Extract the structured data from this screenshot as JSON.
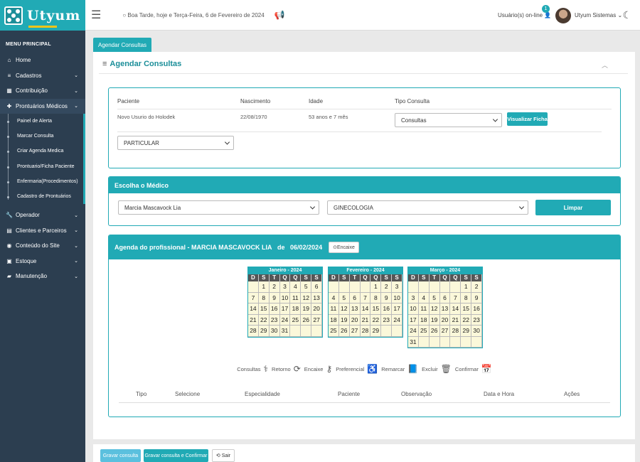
{
  "brand": {
    "name": "Utyum"
  },
  "topbar": {
    "greeting": "Boa Tarde, hoje e Terça-Feira, 6 de Fevereiro de 2024",
    "online_label": "Usuário(s) on-line",
    "online_count": "1",
    "user_name": "Utyum Sistemas"
  },
  "sidebar": {
    "heading": "MENU PRINCIPAL",
    "items": [
      {
        "label": "Home",
        "icon": "home-icon"
      },
      {
        "label": "Cadastros",
        "icon": "database-icon"
      },
      {
        "label": "Contribuição",
        "icon": "table-icon"
      },
      {
        "label": "Prontuários Médicos",
        "icon": "medkit-icon"
      }
    ],
    "sub_items": [
      "Painel de Alerta",
      "Marcar Consulta",
      "Criar Agenda Medica",
      "Prontuario/Ficha Paciente",
      "Enfermaria(Procedimentos)",
      "Cadastro de Prontuários"
    ],
    "items2": [
      {
        "label": "Operador",
        "icon": "wrench-icon"
      },
      {
        "label": "Clientes e Parceiros",
        "icon": "id-card-icon"
      },
      {
        "label": "Conteúdo do Site",
        "icon": "globe-icon"
      },
      {
        "label": "Estoque",
        "icon": "box-icon"
      },
      {
        "label": "Manutenção",
        "icon": "folder-icon"
      }
    ]
  },
  "tab": {
    "label": "Agendar Consultas"
  },
  "page": {
    "title": "Agendar Consultas"
  },
  "patient": {
    "headers": [
      "Paciente",
      "Nascimento",
      "Idade",
      "Tipo Consulta"
    ],
    "name": "Novo Usurio do Holodek",
    "birth": "22/08/1970",
    "age": "53 anos e 7 mês",
    "consult_type": "Consultas",
    "view_button": "Visualizar Ficha",
    "plan": "PARTICULAR"
  },
  "doctor": {
    "title": "Escolha o Médico",
    "doctor": "Marcia Mascavock Lia",
    "specialty": "GINECOLOGIA",
    "clear_button": "Limpar"
  },
  "agenda": {
    "title_prefix": "Agenda do profissional - MARCIA MASCAVOCK LIA",
    "title_de": "de",
    "date": "06/02/2024",
    "encaixe_button": "Encaixe",
    "weekday_headers": [
      "D",
      "S",
      "T",
      "Q",
      "Q",
      "S",
      "S"
    ],
    "calendars": [
      {
        "title": "Janeiro - 2024",
        "offset": 1,
        "days": 31
      },
      {
        "title": "Fevereiro - 2024",
        "offset": 4,
        "days": 29
      },
      {
        "title": "Março - 2024",
        "offset": 5,
        "days": 31
      }
    ],
    "legend": [
      {
        "label": "Consultas",
        "icon": "stethoscope-icon",
        "glyph": "⚕"
      },
      {
        "label": "Retorno",
        "icon": "refresh-icon",
        "glyph": "⟳"
      },
      {
        "label": "Encaixe",
        "icon": "key-icon",
        "glyph": "⚷"
      },
      {
        "label": "Preferencial",
        "icon": "wheelchair-icon",
        "glyph": "♿"
      },
      {
        "label": "Remarcar",
        "icon": "book-icon",
        "glyph": "📘"
      },
      {
        "label": "Excluir",
        "icon": "trash-icon",
        "glyph": "🗑"
      },
      {
        "label": "Confirmar",
        "icon": "calendar-check-icon",
        "glyph": "📅"
      }
    ],
    "table_headers": [
      "Tipo",
      "Selecione",
      "Especialidade",
      "Paciente",
      "Observação",
      "Data e Hora",
      "Ações"
    ]
  },
  "footer": {
    "save": "Gravar consulta",
    "save_confirm": "Gravar consulta e Confirmar",
    "exit": "Sair"
  },
  "colors": {
    "accent": "#21aab5",
    "sidebar": "#2c3e50",
    "calendar_day": "#fbf8da"
  }
}
